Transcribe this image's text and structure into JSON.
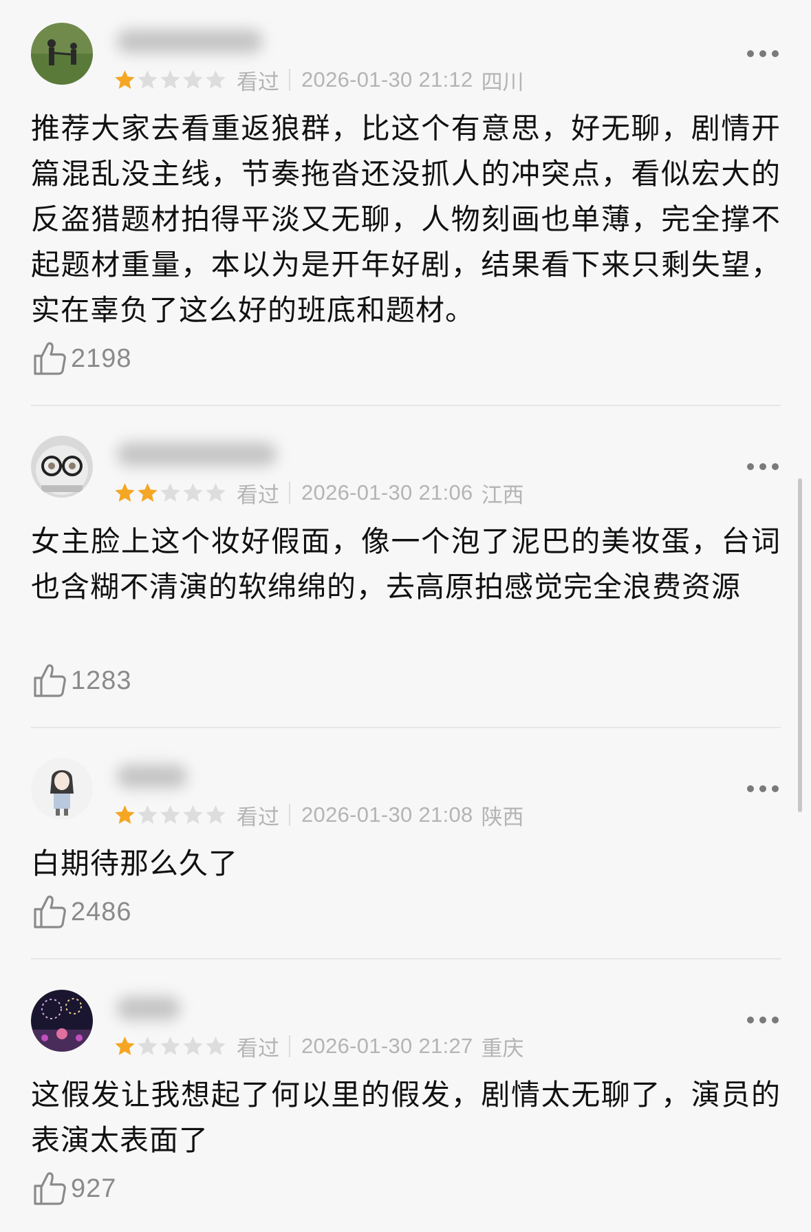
{
  "reviews": [
    {
      "username": "用户",
      "rating": 1,
      "status": "看过",
      "datetime": "2026-01-30 21:12",
      "location": "四川",
      "content": "推荐大家去看重返狼群，比这个有意思，好无聊，剧情开篇混乱没主线，节奏拖沓还没抓人的冲突点，看似宏大的反盗猎题材拍得平淡又无聊，人物刻画也单薄，完全撑不起题材重量，本以为是开年好剧，结果看下来只剩失望，实在辜负了这么好的班底和题材。",
      "likes": "2198"
    },
    {
      "username": "用户",
      "rating": 2,
      "status": "看过",
      "datetime": "2026-01-30 21:06",
      "location": "江西",
      "content": "女主脸上这个妆好假面，像一个泡了泥巴的美妆蛋，台词也含糊不清演的软绵绵的，去高原拍感觉完全浪费资源",
      "likes": "1283"
    },
    {
      "username": "用户",
      "rating": 1,
      "status": "看过",
      "datetime": "2026-01-30 21:08",
      "location": "陕西",
      "content": "白期待那么久了",
      "likes": "2486"
    },
    {
      "username": "用户",
      "rating": 1,
      "status": "看过",
      "datetime": "2026-01-30 21:27",
      "location": "重庆",
      "content": "这假发让我想起了何以里的假发，剧情太无聊了，演员的表演太表面了",
      "likes": "927"
    }
  ],
  "colors": {
    "star_filled": "#f5a623",
    "star_empty": "#dddddd",
    "background": "#f7f7f7"
  }
}
